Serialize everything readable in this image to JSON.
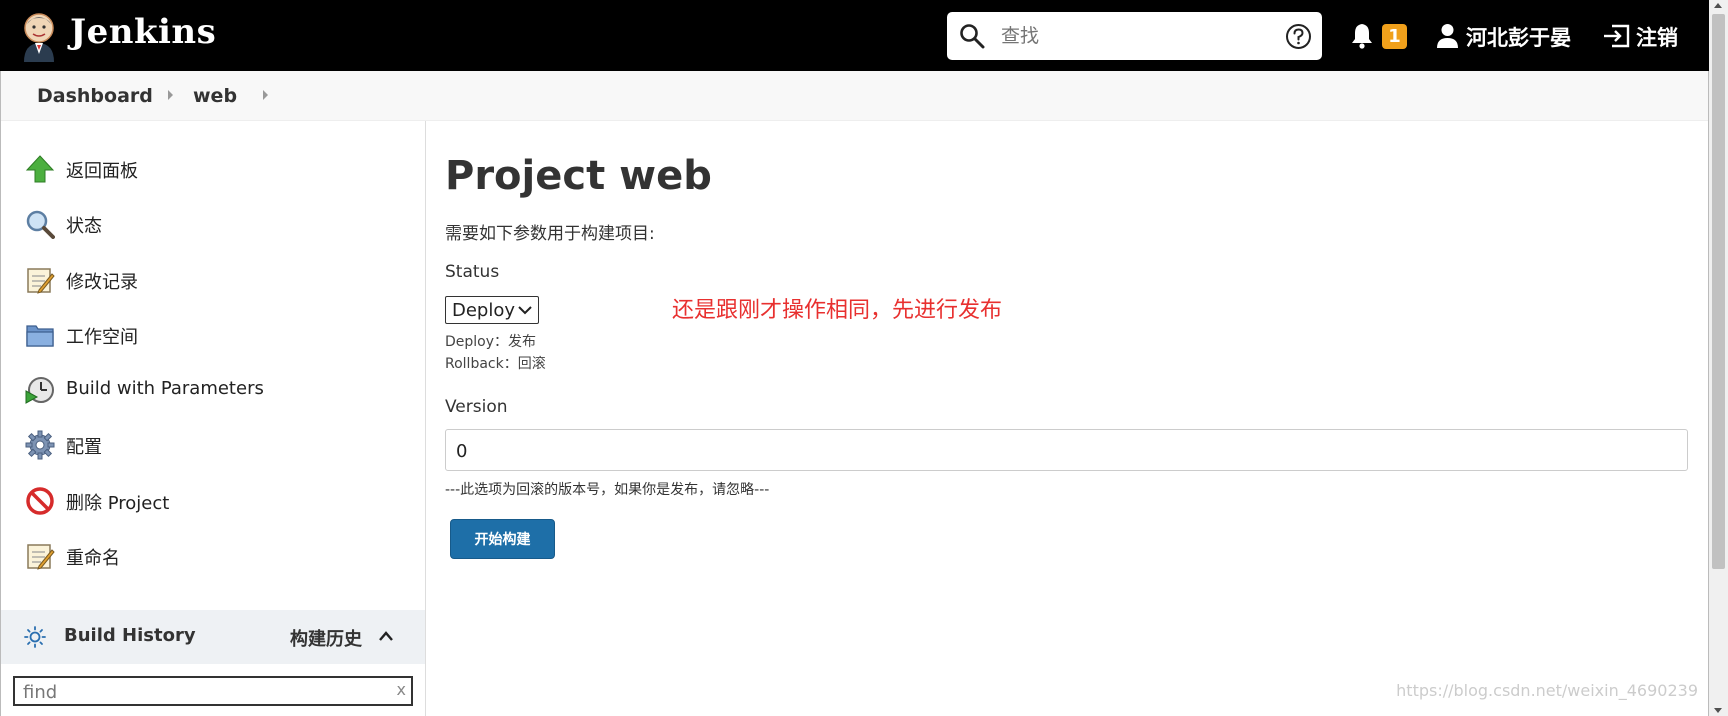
{
  "header": {
    "brand": "Jenkins",
    "search_placeholder": "查找",
    "notification_count": "1",
    "user_name": "河北彭于晏",
    "logout_label": "注销"
  },
  "breadcrumb": [
    "Dashboard",
    "web"
  ],
  "sidebar": {
    "tasks": [
      {
        "label": "返回面板",
        "icon": "up-arrow-icon"
      },
      {
        "label": "状态",
        "icon": "magnifier-icon"
      },
      {
        "label": "修改记录",
        "icon": "notepad-icon"
      },
      {
        "label": "工作空间",
        "icon": "folder-icon"
      },
      {
        "label": "Build with Parameters",
        "icon": "clock-play-icon"
      },
      {
        "label": "配置",
        "icon": "gear-icon"
      },
      {
        "label": "删除 Project",
        "icon": "no-entry-icon"
      },
      {
        "label": "重命名",
        "icon": "notepad-icon"
      }
    ],
    "build_history": {
      "title": "Build History",
      "title_cn": "构建历史",
      "filter_value": "find",
      "clear_label": "x"
    }
  },
  "main": {
    "title": "Project web",
    "description": "需要如下参数用于构建项目:",
    "status_label": "Status",
    "status_selected": "Deploy",
    "status_hints": [
      "Deploy：发布",
      "Rollback：回滚"
    ],
    "annotation": "还是跟刚才操作相同，先进行发布",
    "version_label": "Version",
    "version_value": "0",
    "version_hint": "---此选项为回滚的版本号，如果你是发布，请忽略---",
    "build_button": "开始构建"
  },
  "watermark": "https://blog.csdn.net/weixin_4690239",
  "colors": {
    "header_bg": "#000000",
    "badge": "#f0a01b",
    "primary_button": "#1e6fa8",
    "annotation": "#e8302f"
  }
}
